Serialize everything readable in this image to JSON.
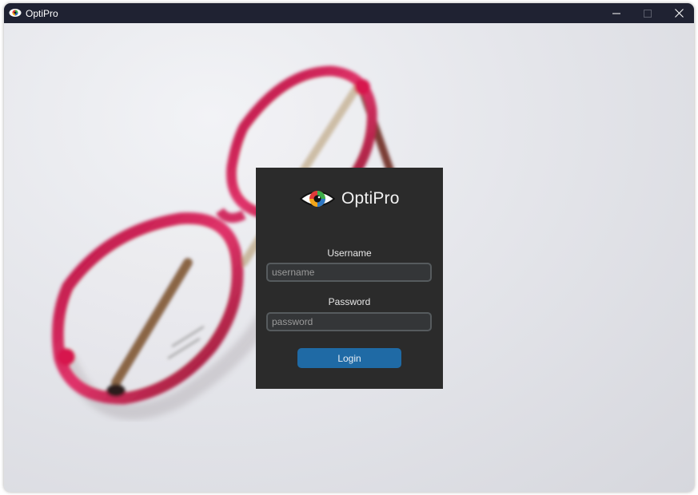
{
  "window": {
    "title": "OptiPro",
    "controls": {
      "minimize_icon": "minimize-icon",
      "maximize_icon": "maximize-icon",
      "close_icon": "close-icon"
    }
  },
  "background": {
    "description_icon": "eyeglasses-photo"
  },
  "login": {
    "brand": "OptiPro",
    "logo_icon": "eye-logo-icon",
    "username_label": "Username",
    "username_placeholder": "username",
    "username_value": "",
    "password_label": "Password",
    "password_placeholder": "password",
    "password_value": "",
    "login_button": "Login"
  },
  "colors": {
    "titlebar": "#1f2232",
    "panel": "#2b2b2b",
    "button": "#1f6aa5",
    "input_bg": "#343638",
    "input_border": "#565b5e",
    "frame_red": "#d42a5c"
  }
}
